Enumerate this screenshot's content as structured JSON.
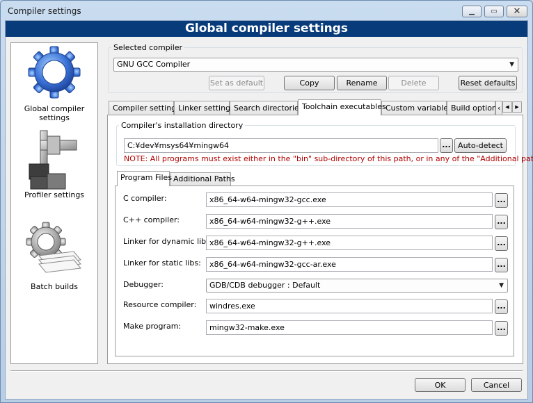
{
  "window": {
    "title": "Compiler settings"
  },
  "banner": {
    "title": "Global compiler settings"
  },
  "sidebar": {
    "items": [
      {
        "label": "Global compiler settings",
        "icon": "gear-icon",
        "selected": true
      },
      {
        "label": "Profiler settings",
        "icon": "profiler-icon",
        "selected": false
      },
      {
        "label": "Batch builds",
        "icon": "batch-build-icon",
        "selected": false
      }
    ]
  },
  "selected_compiler": {
    "group_label": "Selected compiler",
    "value": "GNU GCC Compiler",
    "buttons": {
      "set_default": "Set as default",
      "copy": "Copy",
      "rename": "Rename",
      "delete": "Delete",
      "reset_defaults": "Reset defaults"
    }
  },
  "tabs": [
    "Compiler settings",
    "Linker settings",
    "Search directories",
    "Toolchain executables",
    "Custom variables",
    "Build options",
    "‹",
    "◀",
    "▶"
  ],
  "install_dir": {
    "group_label": "Compiler's installation directory",
    "value": "C:¥dev¥msys64¥mingw64",
    "browse": "...",
    "auto_detect": "Auto-detect",
    "note": "NOTE: All programs must exist either in the \"bin\" sub-directory of this path, or in any of the \"Additional paths\"..."
  },
  "inner_tabs": [
    "Program Files",
    "Additional Paths"
  ],
  "programs": {
    "c_compiler": {
      "label": "C compiler:",
      "value": "x86_64-w64-mingw32-gcc.exe"
    },
    "cpp_compiler": {
      "label": "C++ compiler:",
      "value": "x86_64-w64-mingw32-g++.exe"
    },
    "linker_dynamic": {
      "label": "Linker for dynamic libs:",
      "value": "x86_64-w64-mingw32-g++.exe"
    },
    "linker_static": {
      "label": "Linker for static libs:",
      "value": "x86_64-w64-mingw32-gcc-ar.exe"
    },
    "debugger": {
      "label": "Debugger:",
      "value": "GDB/CDB debugger : Default"
    },
    "resource_compiler": {
      "label": "Resource compiler:",
      "value": "windres.exe"
    },
    "make_program": {
      "label": "Make program:",
      "value": "mingw32-make.exe"
    },
    "browse": "..."
  },
  "footer": {
    "ok": "OK",
    "cancel": "Cancel"
  }
}
